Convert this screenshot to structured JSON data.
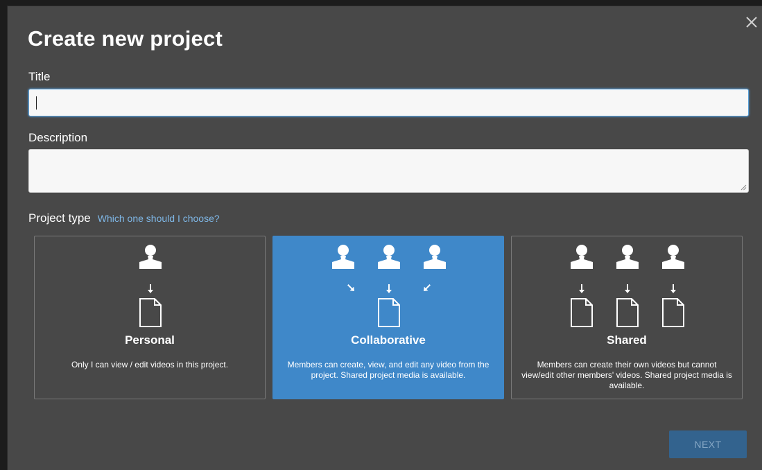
{
  "dialog": {
    "title": "Create new project",
    "close_icon": "close-icon"
  },
  "form": {
    "title_label": "Title",
    "title_value": "",
    "description_label": "Description",
    "description_value": "",
    "project_type_label": "Project type",
    "help_link": "Which one should I choose?"
  },
  "project_types": [
    {
      "name": "Personal",
      "description": "Only I can view / edit videos in this project.",
      "selected": false,
      "icon": "single-user-to-document-icon"
    },
    {
      "name": "Collaborative",
      "description": "Members can create, view, and edit any video from the project. Shared project media is available.",
      "selected": true,
      "icon": "users-to-one-document-icon"
    },
    {
      "name": "Shared",
      "description": "Members can create their own videos but cannot view/edit other members' videos. Shared project media is available.",
      "selected": false,
      "icon": "users-to-own-documents-icon"
    }
  ],
  "footer": {
    "next_label": "NEXT",
    "next_enabled": false
  },
  "colors": {
    "dialog_bg": "#484848",
    "accent": "#3f88c9",
    "link": "#7fb7e6",
    "next_disabled_bg": "#33638e"
  }
}
